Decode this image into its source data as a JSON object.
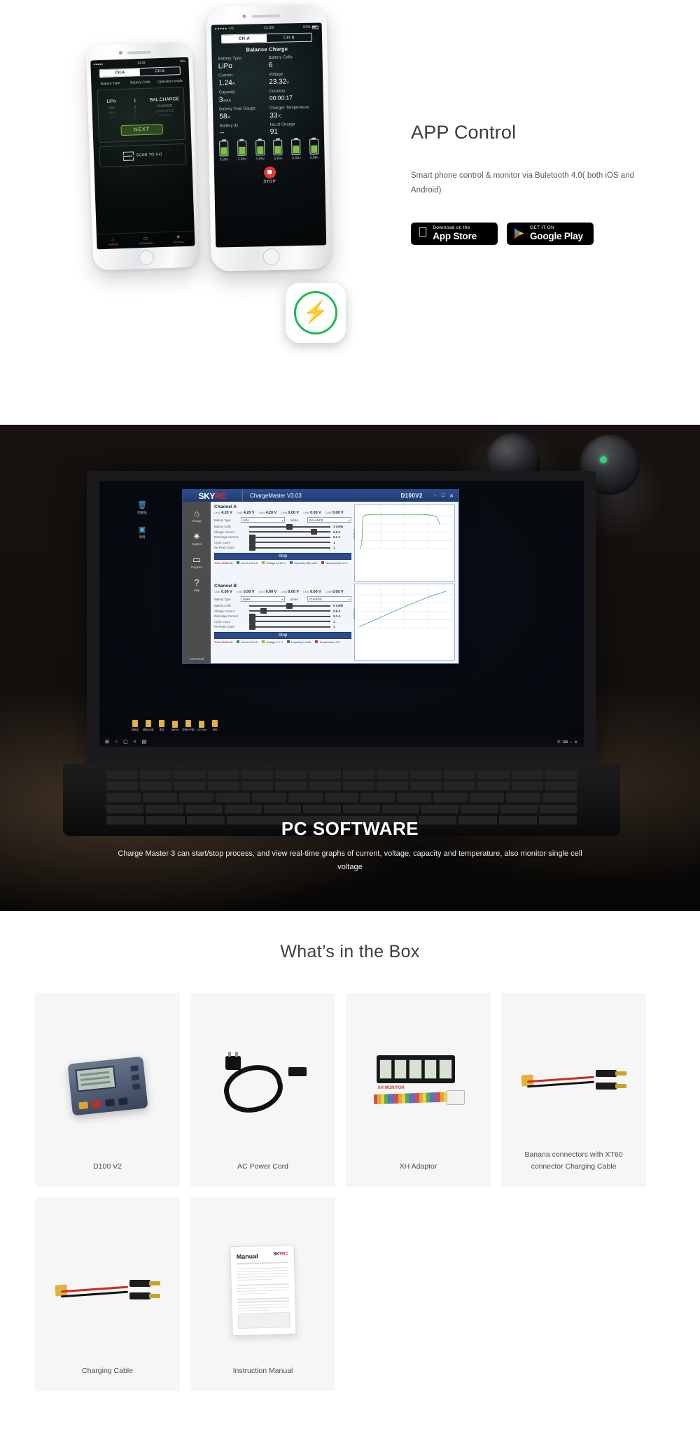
{
  "app_section": {
    "heading": "APP Control",
    "description": "Smart phone control & monitor via Buletooth 4.0( both iOS and Android)",
    "stores": [
      {
        "small": "Download on the",
        "large": "App Store",
        "icon": "apple-icon"
      },
      {
        "small": "GET IT ON",
        "large": "Google Play",
        "icon": "google-play-icon"
      }
    ],
    "phone_small": {
      "statusbar": {
        "signal": "●●●●●",
        "carrier": "4G",
        "time": "14:26",
        "battery": "78%"
      },
      "tabs": [
        "CH.A",
        "CH.B"
      ],
      "active_tab": "CH.A",
      "column_headers": [
        "Battery Type",
        "Battery Cells",
        "Operation Mode"
      ],
      "battery_types": [
        "LiPo",
        "LiIo",
        "LiFe",
        "LiHv"
      ],
      "cell_counts": [
        "1",
        "2",
        "3",
        "4"
      ],
      "modes": [
        "BAL.CHARGE",
        "CHARGE",
        "DISCHARGE",
        "STORAGE"
      ],
      "next_button": "NEXT",
      "scan_label": "SCAN TO GO",
      "nav": [
        "CHARGE",
        "PROGRAM",
        "SYSTEM"
      ]
    },
    "phone_big": {
      "statusbar": {
        "signal": "●●●●●",
        "carrier": "4G",
        "time": "11:33",
        "battery": "91%"
      },
      "tabs": [
        "CH.A",
        "CH.B"
      ],
      "active_tab": "CH.A",
      "screen_title": "Balance Charge",
      "fields": [
        {
          "label": "Battery Type",
          "value": "LiPo",
          "unit": ""
        },
        {
          "label": "Battery Cells",
          "value": "6",
          "unit": ""
        },
        {
          "label": "Current",
          "value": "1.24",
          "unit": "A"
        },
        {
          "label": "Voltage",
          "value": "23.32",
          "unit": "V"
        },
        {
          "label": "Capacity",
          "value": "3",
          "unit": "mAh"
        },
        {
          "label": "Duration",
          "value": "00:00:17",
          "unit": ""
        },
        {
          "label": "Battery Fuel Gauge",
          "value": "58",
          "unit": "%"
        },
        {
          "label": "Charger Temperature",
          "value": "33",
          "unit": "℃"
        },
        {
          "label": "Battery ID",
          "value": "--",
          "unit": ""
        },
        {
          "label": "No.of Charge",
          "value": "91",
          "unit": ""
        }
      ],
      "cells": [
        {
          "voltage": "3.88",
          "unit": "V",
          "fill": 62
        },
        {
          "voltage": "3.89",
          "unit": "V",
          "fill": 64
        },
        {
          "voltage": "3.89",
          "unit": "V",
          "fill": 64
        },
        {
          "voltage": "3.90",
          "unit": "V",
          "fill": 66
        },
        {
          "voltage": "3.88",
          "unit": "V",
          "fill": 62
        },
        {
          "voltage": "3.88",
          "unit": "V",
          "fill": 62
        }
      ],
      "stop_label": "STOP"
    },
    "badge_icon": "lightning-bolt-icon"
  },
  "pc_section": {
    "heading": "PC SOFTWARE",
    "description": "Charge Master 3 can start/stop process, and view real-time graphs of current, voltage, capacity and temperature, also monitor single cell voltage",
    "window": {
      "brand_sky": "SKY",
      "brand_rc": "RC",
      "app_title": "ChargeMaster V3.03",
      "model": "D100V2",
      "window_buttons": [
        "−",
        "□",
        "✕"
      ],
      "sidebar": [
        {
          "icon": "home-icon",
          "label": "Charge",
          "glyph": "⌂"
        },
        {
          "icon": "gear-icon",
          "label": "System",
          "glyph": "✷"
        },
        {
          "icon": "folder-icon",
          "label": "Program",
          "glyph": "▭"
        },
        {
          "icon": "help-icon",
          "label": "Help",
          "glyph": "?"
        }
      ],
      "status": "Connected",
      "channels": [
        {
          "title": "Channel A",
          "cells": [
            {
              "k": "Cell1",
              "v": "4.20 V"
            },
            {
              "k": "Cell2",
              "v": "4.20 V"
            },
            {
              "k": "Cell3",
              "v": "4.20 V"
            },
            {
              "k": "Cell4",
              "v": "0.00 V"
            },
            {
              "k": "Cell5",
              "v": "0.00 V"
            },
            {
              "k": "Cell6",
              "v": "0.00 V"
            }
          ],
          "battery_type_label": "Battery Type:",
          "battery_type": "LiPo",
          "mode_label": "Mode:",
          "mode": "BALANCE",
          "sliders": [
            {
              "label": "Battery Cells",
              "value": "3 Cells",
              "pos": 46
            },
            {
              "label": "Charge Current",
              "value": "5.0 A",
              "pos": 76
            },
            {
              "label": "Discharge Current",
              "value": "0.1 A",
              "pos": 2
            },
            {
              "label": "Cycle Count",
              "value": "1",
              "pos": 2
            },
            {
              "label": "Re-Peak Count",
              "value": "1",
              "pos": 2
            }
          ],
          "action_button": "Stop",
          "time_label": "Time 00:04:26",
          "legend": [
            {
              "name": "Current 3.4 A",
              "color": "#2e8b57"
            },
            {
              "name": "Voltage 12.60 V",
              "color": "#c8a52b"
            },
            {
              "name": "Capacity 355 mAh",
              "color": "#2f6fb5"
            },
            {
              "name": "Temperature 41 C",
              "color": "#b0463a"
            }
          ],
          "graph_ylabel": "Current A"
        },
        {
          "title": "Channel B",
          "cells": [
            {
              "k": "Cell1",
              "v": "0.00 V"
            },
            {
              "k": "Cell2",
              "v": "0.00 V"
            },
            {
              "k": "Cell3",
              "v": "0.00 V"
            },
            {
              "k": "Cell4",
              "v": "0.00 V"
            },
            {
              "k": "Cell5",
              "v": "0.00 V"
            },
            {
              "k": "Cell6",
              "v": "0.00 V"
            }
          ],
          "battery_type_label": "Battery Type:",
          "battery_type": "NiMH",
          "mode_label": "Mode:",
          "mode": "CHARGE",
          "sliders": [
            {
              "label": "Battery Cells",
              "value": "6 Cells",
              "pos": 46
            },
            {
              "label": "Charge Current",
              "value": "0.6 A",
              "pos": 14
            },
            {
              "label": "Discharge Current",
              "value": "0.1 A",
              "pos": 2
            },
            {
              "label": "Cycle Count",
              "value": "1",
              "pos": 2
            },
            {
              "label": "Re-Peak Count",
              "value": "1",
              "pos": 2
            }
          ],
          "action_button": "Stop",
          "time_label": "Time 00:00:00",
          "legend": [
            {
              "name": "Current 0.0 A",
              "color": "#2e8b57"
            },
            {
              "name": "Voltage 0.1 V",
              "color": "#c8a52b"
            },
            {
              "name": "Capacity 0 mAh",
              "color": "#2f6fb5"
            },
            {
              "name": "Temperature 0 C",
              "color": "#b0463a"
            }
          ],
          "graph_ylabel": "Current A"
        }
      ]
    },
    "desktop": {
      "taskbar_files": [
        "回收站",
        "腾讯QQ电",
        "项目",
        "MyDoc",
        "导航APP图",
        "CorCope",
        "说明"
      ],
      "tray": "中 ⌨ ♪ ⚙",
      "clock": ""
    }
  },
  "box_section": {
    "title": "What’s in the Box",
    "items": [
      {
        "label": "D100 V2",
        "art": "charger-icon"
      },
      {
        "label": "AC Power Cord",
        "art": "power-cord-icon"
      },
      {
        "label": "XH Adaptor",
        "art": "xh-adaptor-icon"
      },
      {
        "label": "Banana connectors with XT60 connector Charging Cable",
        "art": "banana-xt60-icon"
      },
      {
        "label": "Charging Cable",
        "art": "charging-cable-icon"
      },
      {
        "label": "Instruction Manual",
        "art": "manual-icon"
      }
    ],
    "manual_art": {
      "heading": "Manual",
      "brand_sky": "SKY",
      "brand_rc": "RC"
    },
    "adaptor_art": {
      "label": "XH MONITOR"
    }
  }
}
